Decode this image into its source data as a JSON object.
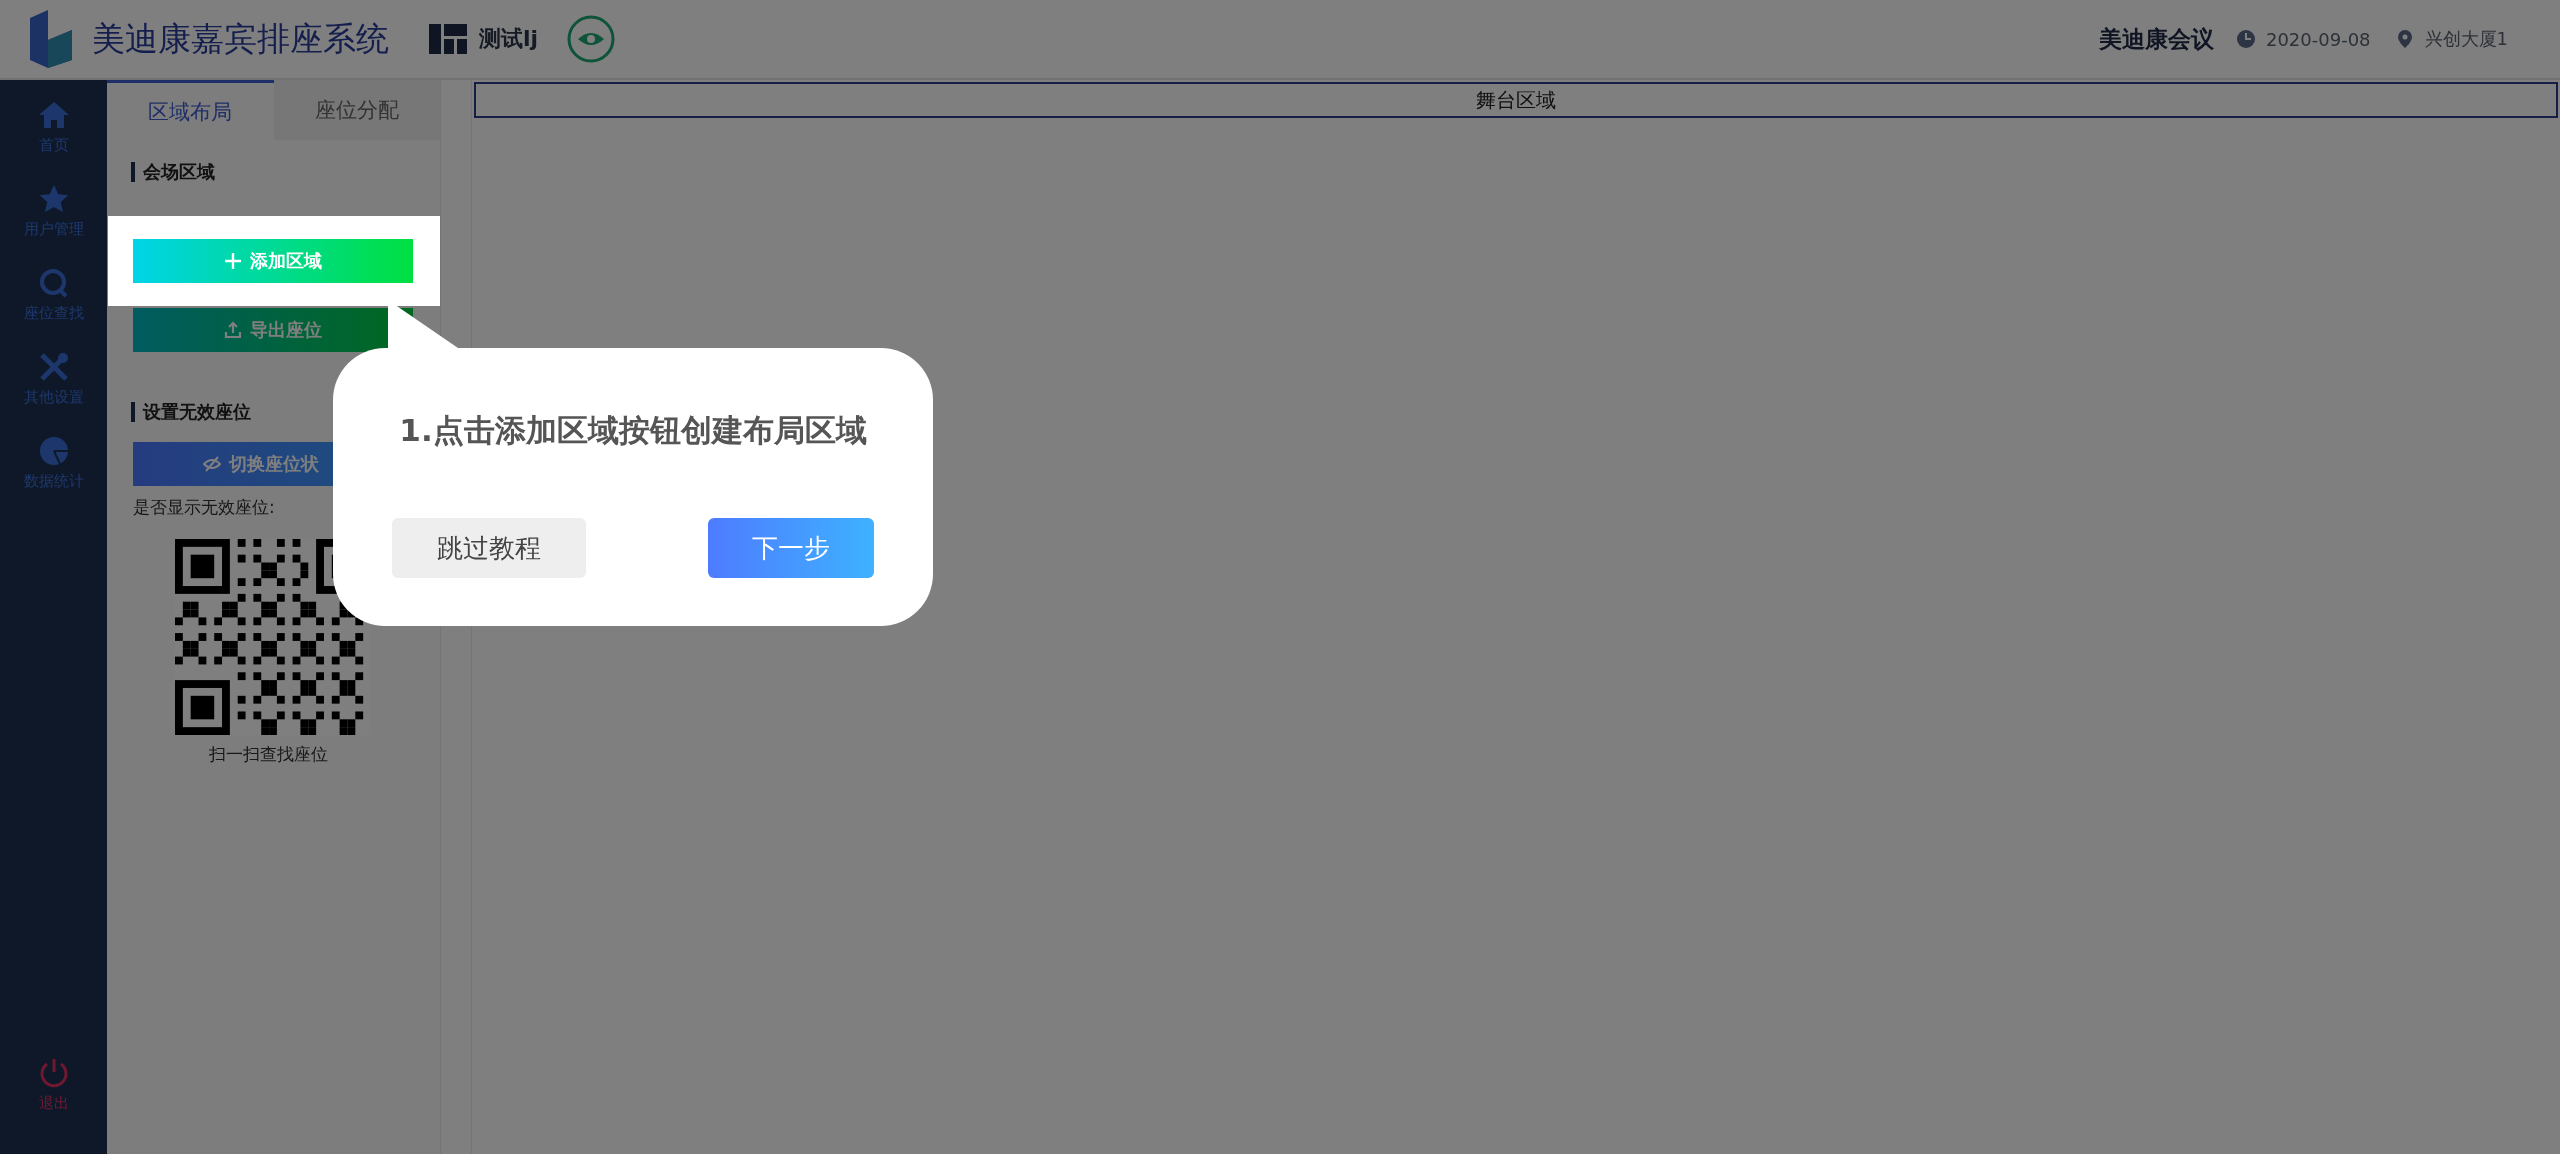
{
  "header": {
    "app_title": "美迪康嘉宾排座系统",
    "project_name": "测试lj",
    "meeting_name": "美迪康会议",
    "date": "2020-09-08",
    "venue": "兴创大厦1"
  },
  "sidebar": {
    "items": [
      {
        "label": "首页"
      },
      {
        "label": "用户管理"
      },
      {
        "label": "座位查找"
      },
      {
        "label": "其他设置"
      },
      {
        "label": "数据统计"
      }
    ],
    "logout": "退出"
  },
  "panel": {
    "tabs": [
      {
        "label": "区域布局",
        "selected": true
      },
      {
        "label": "座位分配",
        "selected": false
      }
    ],
    "venue_section": {
      "title": "会场区域",
      "add_button": "添加区域",
      "export_button": "导出座位"
    },
    "invalid_section": {
      "title": "设置无效座位",
      "toggle_button": "切换座位状",
      "show_label": "是否显示无效座位:",
      "qr_caption": "扫一扫查找座位"
    }
  },
  "stage": {
    "label": "舞台区域"
  },
  "tour": {
    "message": "1.点击添加区域按钮创建布局区域",
    "skip_button": "跳过教程",
    "next_button": "下一步"
  }
}
